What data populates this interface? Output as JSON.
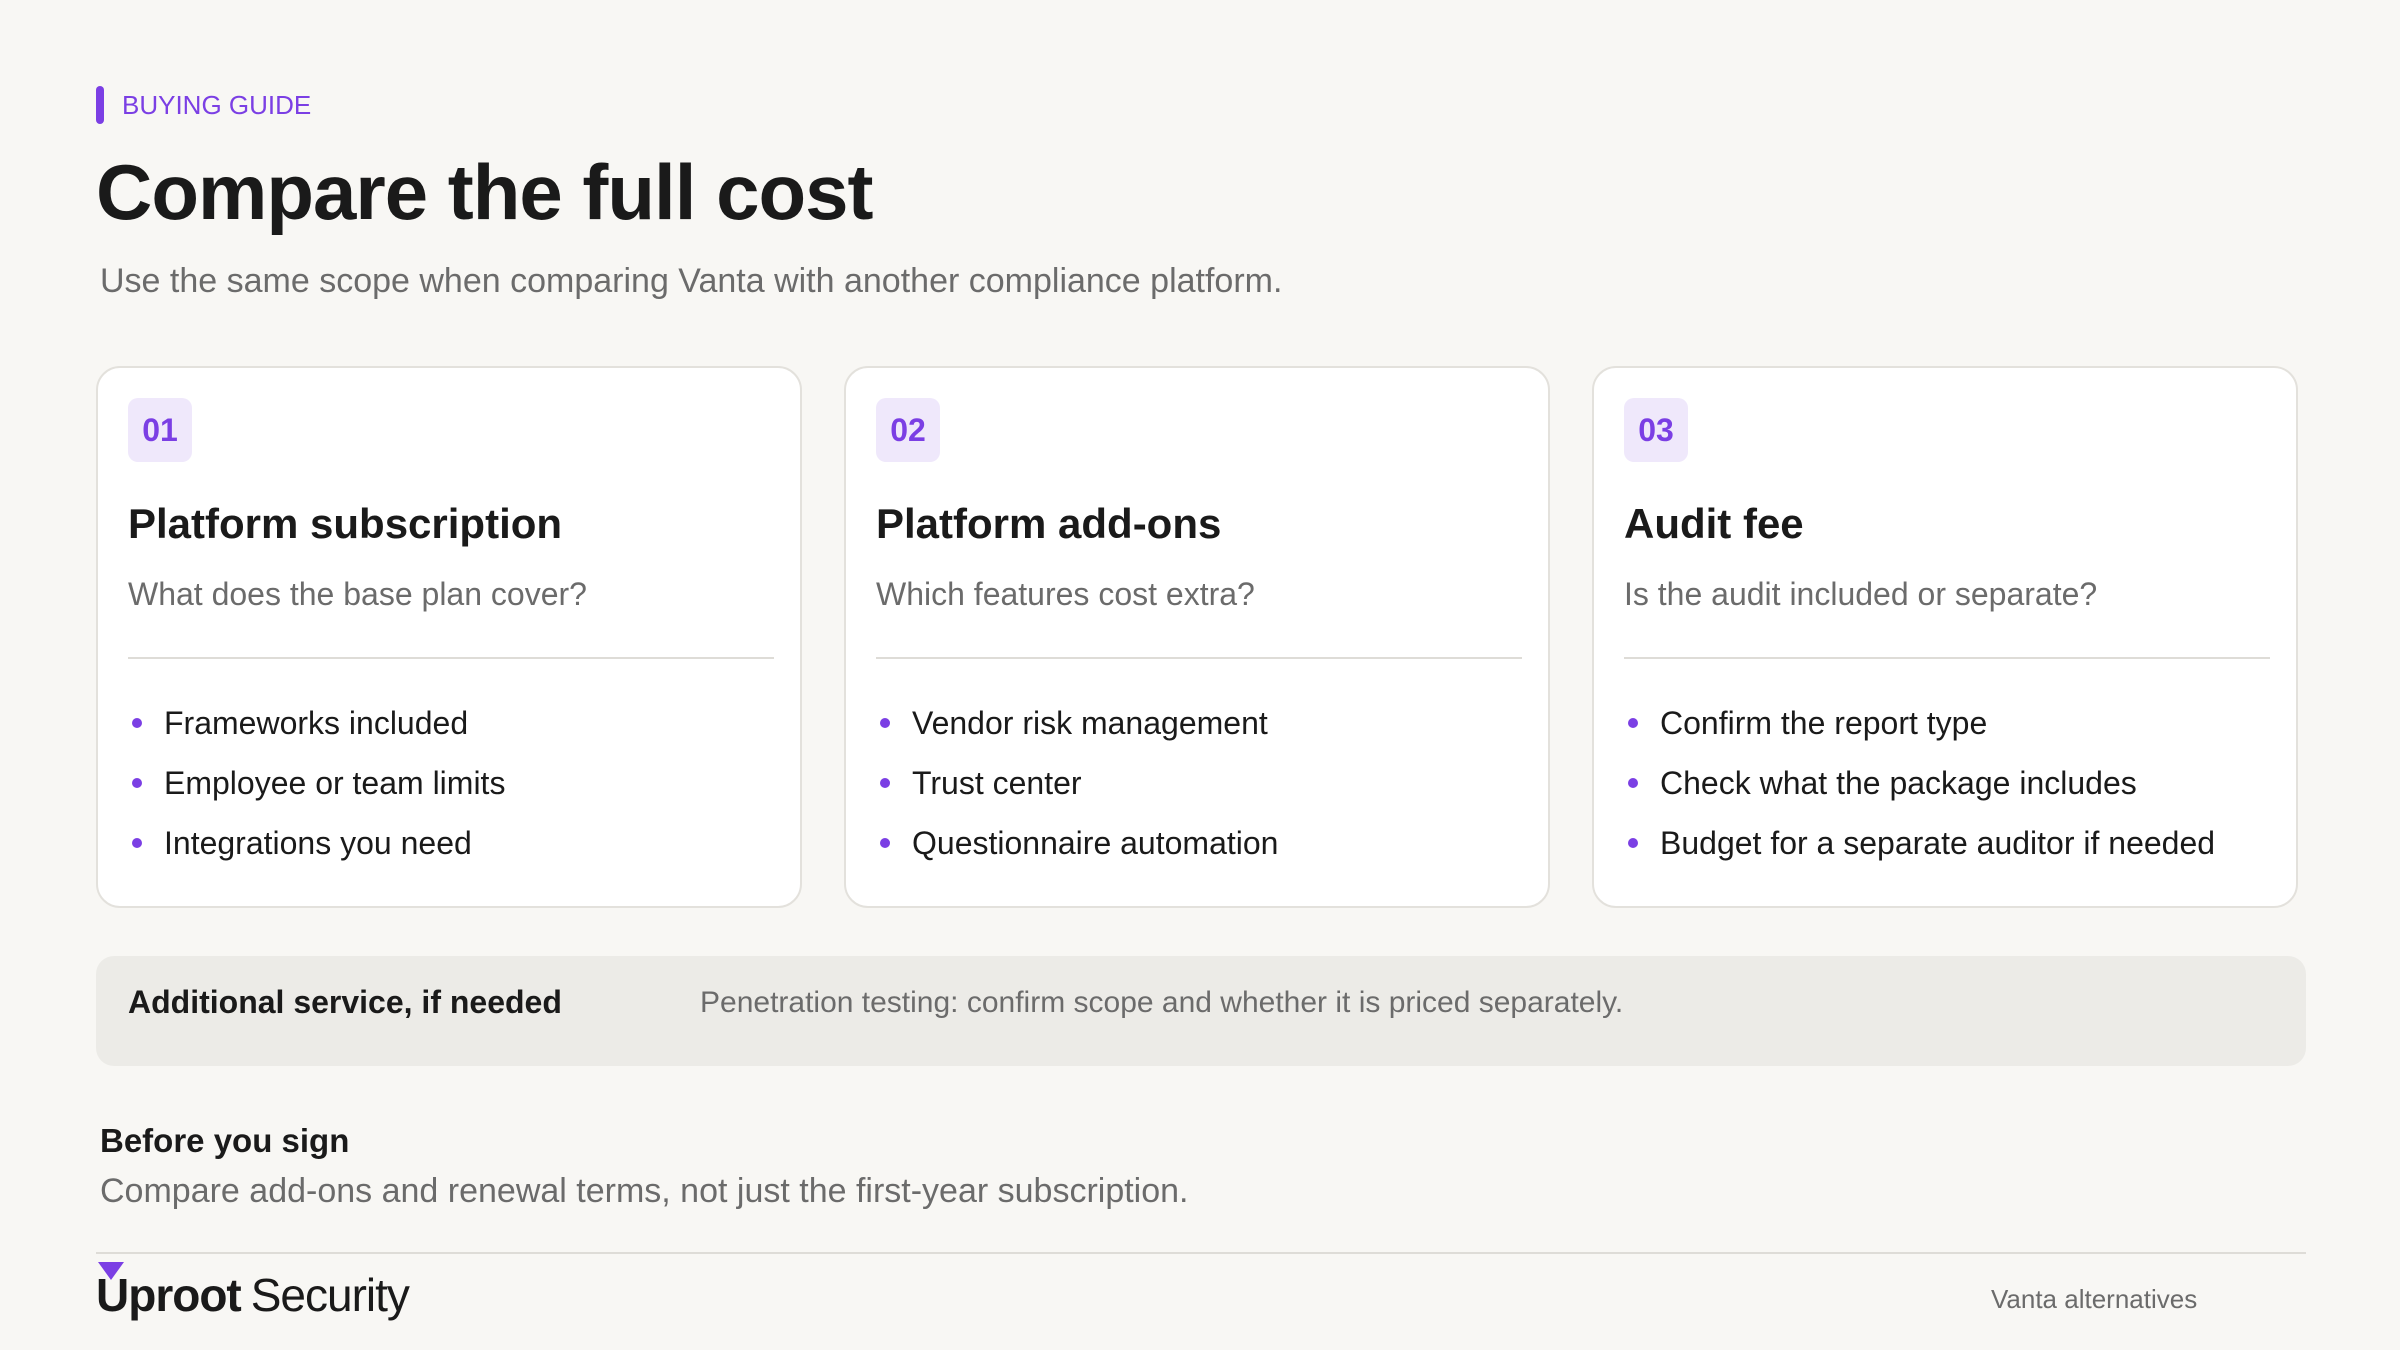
{
  "eyebrow": "BUYING GUIDE",
  "title": "Compare the full cost",
  "subtitle": "Use the same scope when comparing Vanta with another compliance platform.",
  "cards": [
    {
      "number": "01",
      "title": "Platform subscription",
      "question": "What does the base plan cover?",
      "items": [
        "Frameworks included",
        "Employee or team limits",
        "Integrations you need"
      ]
    },
    {
      "number": "02",
      "title": "Platform add-ons",
      "question": "Which features cost extra?",
      "items": [
        "Vendor risk management",
        "Trust center",
        "Questionnaire automation"
      ]
    },
    {
      "number": "03",
      "title": "Audit fee",
      "question": "Is the audit included or separate?",
      "items": [
        "Confirm the report type",
        "Check what the package includes",
        "Budget for a separate auditor if needed"
      ]
    }
  ],
  "additional": {
    "label": "Additional service, if needed",
    "text": "Penetration testing: confirm scope and whether it is priced separately."
  },
  "before": {
    "title": "Before you sign",
    "text": "Compare add-ons and renewal terms, not just the first-year subscription."
  },
  "footer": {
    "brand_strong": "Uproot",
    "brand_light": "Security",
    "right_text": "Vanta alternatives"
  },
  "colors": {
    "accent": "#7b3fe4",
    "background": "#f8f7f4",
    "badge_bg": "#efe8fb"
  }
}
